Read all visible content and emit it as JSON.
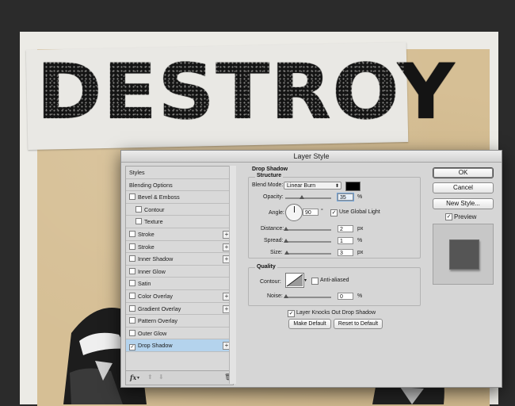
{
  "canvas": {
    "title_word": "DESTROY"
  },
  "dialog": {
    "title": "Layer Style",
    "styles_list": [
      {
        "label": "Styles",
        "checkbox": false,
        "checked": false,
        "plus": false,
        "indent": false,
        "selected": false
      },
      {
        "label": "Blending Options",
        "checkbox": false,
        "checked": false,
        "plus": false,
        "indent": false,
        "selected": false
      },
      {
        "label": "Bevel & Emboss",
        "checkbox": true,
        "checked": false,
        "plus": false,
        "indent": false,
        "selected": false
      },
      {
        "label": "Contour",
        "checkbox": true,
        "checked": false,
        "plus": false,
        "indent": true,
        "selected": false
      },
      {
        "label": "Texture",
        "checkbox": true,
        "checked": false,
        "plus": false,
        "indent": true,
        "selected": false
      },
      {
        "label": "Stroke",
        "checkbox": true,
        "checked": false,
        "plus": true,
        "indent": false,
        "selected": false
      },
      {
        "label": "Stroke",
        "checkbox": true,
        "checked": false,
        "plus": true,
        "indent": false,
        "selected": false
      },
      {
        "label": "Inner Shadow",
        "checkbox": true,
        "checked": false,
        "plus": true,
        "indent": false,
        "selected": false
      },
      {
        "label": "Inner Glow",
        "checkbox": true,
        "checked": false,
        "plus": false,
        "indent": false,
        "selected": false
      },
      {
        "label": "Satin",
        "checkbox": true,
        "checked": false,
        "plus": false,
        "indent": false,
        "selected": false
      },
      {
        "label": "Color Overlay",
        "checkbox": true,
        "checked": false,
        "plus": true,
        "indent": false,
        "selected": false
      },
      {
        "label": "Gradient Overlay",
        "checkbox": true,
        "checked": false,
        "plus": true,
        "indent": false,
        "selected": false
      },
      {
        "label": "Pattern Overlay",
        "checkbox": true,
        "checked": false,
        "plus": false,
        "indent": false,
        "selected": false
      },
      {
        "label": "Outer Glow",
        "checkbox": true,
        "checked": false,
        "plus": false,
        "indent": false,
        "selected": false
      },
      {
        "label": "Drop Shadow",
        "checkbox": true,
        "checked": true,
        "plus": true,
        "indent": false,
        "selected": true
      }
    ],
    "footer_icons": [
      "fx-icon",
      "arrow-up-icon",
      "arrow-down-icon",
      "trash-icon"
    ],
    "drop_shadow": {
      "section_title": "Drop Shadow",
      "structure_title": "Structure",
      "blend_mode_label": "Blend Mode:",
      "blend_mode_value": "Linear Burn",
      "shadow_color": "#000000",
      "opacity_label": "Opacity:",
      "opacity_value": "35",
      "opacity_unit": "%",
      "angle_label": "Angle:",
      "angle_value": "90",
      "angle_unit": "°",
      "use_global_light_label": "Use Global Light",
      "use_global_light_checked": true,
      "distance_label": "Distance:",
      "distance_value": "2",
      "distance_unit": "px",
      "spread_label": "Spread:",
      "spread_value": "1",
      "spread_unit": "%",
      "size_label": "Size:",
      "size_value": "3",
      "size_unit": "px",
      "quality_title": "Quality",
      "contour_label": "Contour:",
      "anti_aliased_label": "Anti-aliased",
      "anti_aliased_checked": false,
      "noise_label": "Noise:",
      "noise_value": "0",
      "noise_unit": "%",
      "knockout_label": "Layer Knocks Out Drop Shadow",
      "knockout_checked": true,
      "make_default_label": "Make Default",
      "reset_default_label": "Reset to Default"
    },
    "buttons": {
      "ok": "OK",
      "cancel": "Cancel",
      "new_style": "New Style...",
      "preview_label": "Preview",
      "preview_checked": true
    }
  }
}
